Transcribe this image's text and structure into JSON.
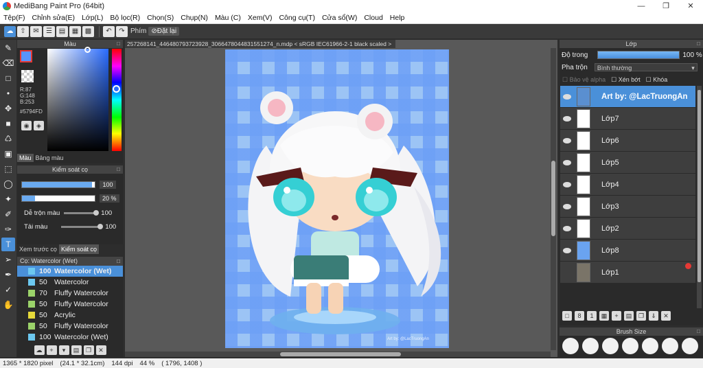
{
  "window": {
    "title": "MediBang Paint Pro (64bit)"
  },
  "menu": [
    "Tệp(F)",
    "Chỉnh sửa(E)",
    "Lớp(L)",
    "Bộ lọc(R)",
    "Chọn(S)",
    "Chụp(N)",
    "Màu (C)",
    "Xem(V)",
    "Công cụ(T)",
    "Cửa sổ(W)",
    "Cloud",
    "Help"
  ],
  "toolbar": {
    "shortcut_label": "Phím",
    "reset_label": "Đặt lại"
  },
  "color_panel": {
    "title": "Màu",
    "r": "R:87",
    "g": "G:148",
    "b": "B:253",
    "hex": "#5794FD",
    "tab_color": "Màu",
    "tab_palette": "Bảng màu",
    "current_color": "#5794FD"
  },
  "brush_control": {
    "title": "Kiểm soát cọ",
    "size_value": "100",
    "size_fraction": 0.96,
    "opacity_value": "20 %",
    "opacity_fraction": 0.18,
    "mix_label": "Dễ trộn màu",
    "mix_value": "100",
    "amount_label": "Tải màu",
    "amount_value": "100"
  },
  "tabs2": {
    "preview": "Xem trước cọ",
    "control": "Kiểm soát cọ"
  },
  "brush_list": {
    "header": "Cọ: Watercolor (Wet)",
    "items": [
      {
        "size": "100",
        "name": "Watercolor (Wet)",
        "color": "#6cc8f0",
        "selected": true
      },
      {
        "size": "50",
        "name": "Watercolor",
        "color": "#6cc8f0"
      },
      {
        "size": "70",
        "name": "Fluffy Watercolor",
        "color": "#9bd36a"
      },
      {
        "size": "50",
        "name": "Fluffy Watercolor",
        "color": "#9bd36a"
      },
      {
        "size": "50",
        "name": "Acrylic",
        "color": "#e6d93a"
      },
      {
        "size": "50",
        "name": "Fluffy Watercolor",
        "color": "#9bd36a"
      },
      {
        "size": "100",
        "name": "Watercolor (Wet)",
        "color": "#6cc8f0"
      }
    ]
  },
  "canvas": {
    "doc_tab": "257268141_446480793723928_3066478044831551274_n.mdp < sRGB IEC61966-2-1 black scaled >",
    "signature": "Art by: @LacTruongAn"
  },
  "layer_panel": {
    "title": "Lớp",
    "opacity_label": "Độ trong",
    "opacity_value": "100 %",
    "blend_label": "Pha trộn",
    "blend_value": "Bình thường",
    "protect_alpha": "Bảo vệ alpha",
    "clip": "Xén bớt",
    "lock": "Khóa",
    "layers": [
      "Art by: @LacTruongAn",
      "Lớp7",
      "Lớp6",
      "Lớp5",
      "Lớp4",
      "Lớp3",
      "Lớp2",
      "Lớp8",
      "Lớp1"
    ]
  },
  "brush_size": {
    "title": "Brush Size"
  },
  "status": {
    "dims": "1365 * 1820 pixel",
    "cm": "(24.1 * 32.1cm)",
    "dpi": "144 dpi",
    "zoom": "44 %",
    "coords": "( 1796, 1408 )"
  }
}
